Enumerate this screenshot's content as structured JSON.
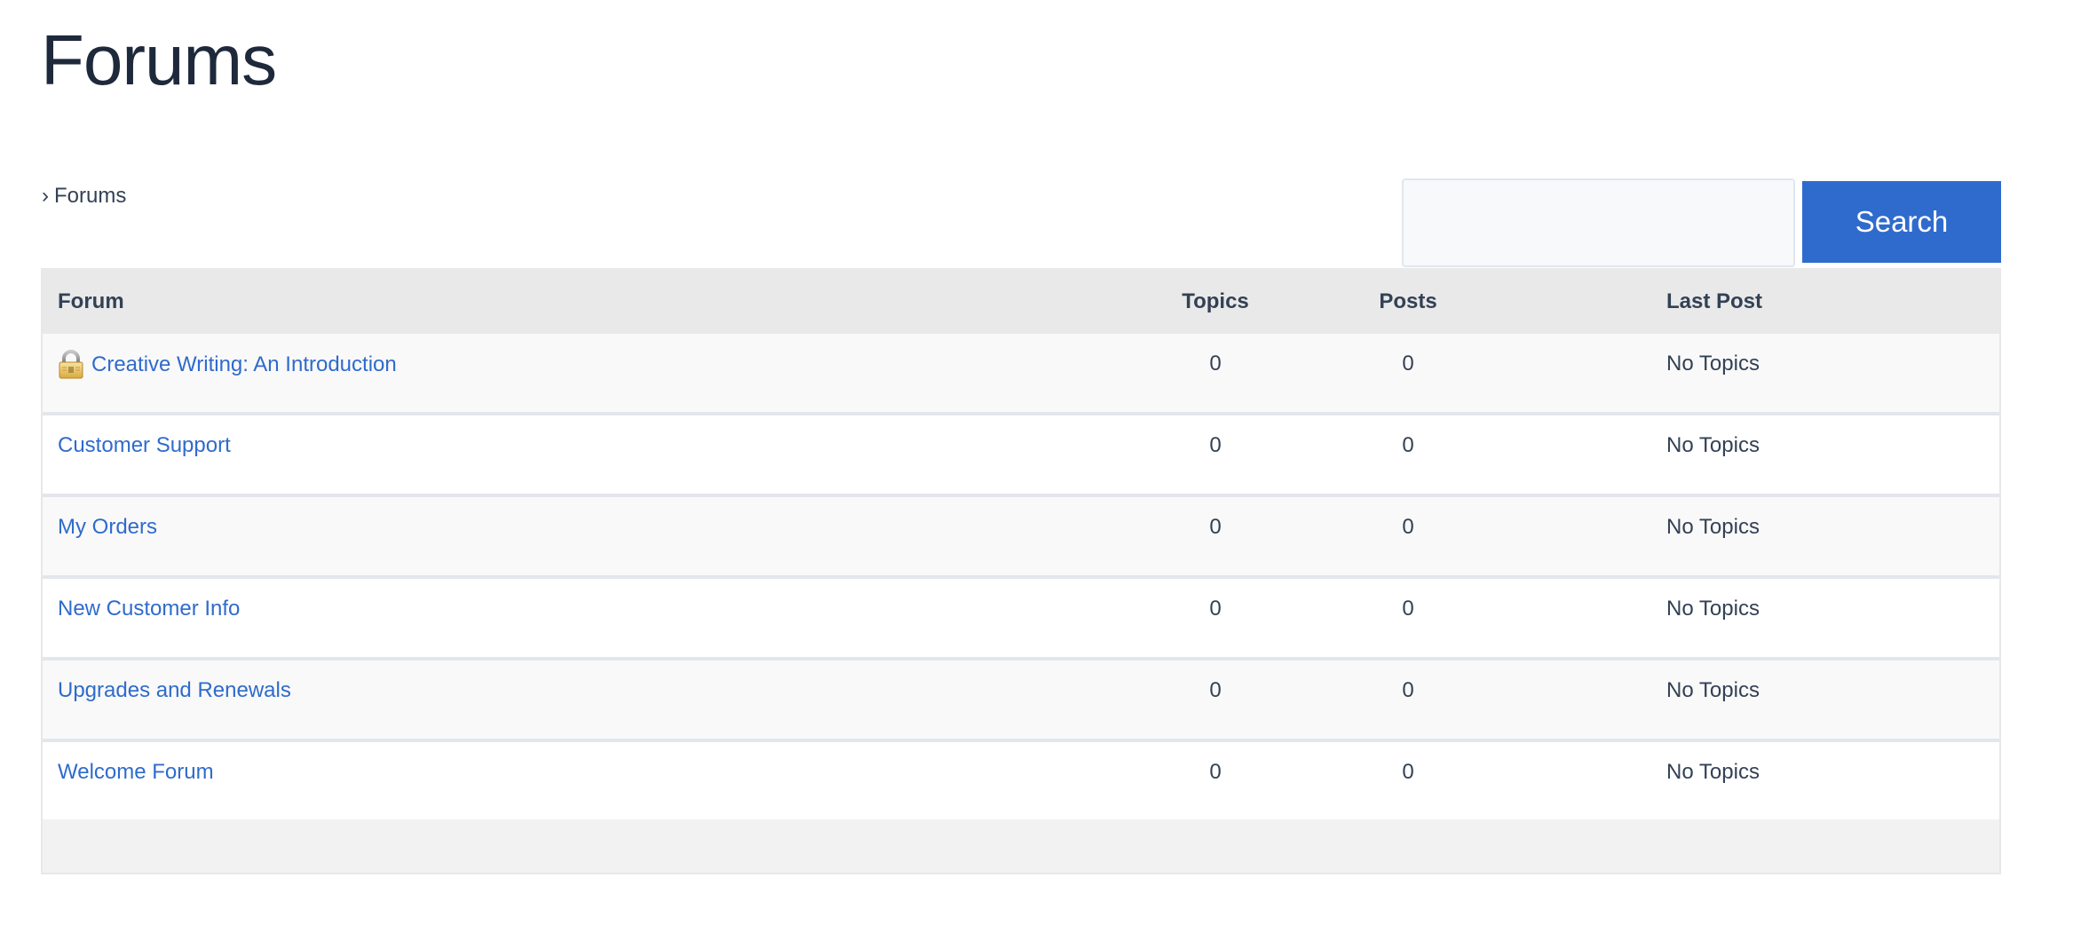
{
  "page": {
    "title": "Forums"
  },
  "breadcrumb": {
    "separator": "›",
    "current": "Forums"
  },
  "search": {
    "input_value": "",
    "placeholder": "",
    "button_label": "Search"
  },
  "table": {
    "headers": {
      "forum": "Forum",
      "topics": "Topics",
      "posts": "Posts",
      "last_post": "Last Post"
    },
    "rows": [
      {
        "name": "Creative Writing: An Introduction",
        "locked": true,
        "icon": "lock-icon",
        "topics": "0",
        "posts": "0",
        "last_post": "No Topics"
      },
      {
        "name": "Customer Support",
        "locked": false,
        "topics": "0",
        "posts": "0",
        "last_post": "No Topics"
      },
      {
        "name": "My Orders",
        "locked": false,
        "topics": "0",
        "posts": "0",
        "last_post": "No Topics"
      },
      {
        "name": "New Customer Info",
        "locked": false,
        "topics": "0",
        "posts": "0",
        "last_post": "No Topics"
      },
      {
        "name": "Upgrades and Renewals",
        "locked": false,
        "topics": "0",
        "posts": "0",
        "last_post": "No Topics"
      },
      {
        "name": "Welcome Forum",
        "locked": false,
        "topics": "0",
        "posts": "0",
        "last_post": "No Topics"
      }
    ]
  },
  "colors": {
    "link": "#2f6bcc",
    "button": "#2f6bcd",
    "title": "#1e293b",
    "header_bg": "#e9e9e9"
  }
}
